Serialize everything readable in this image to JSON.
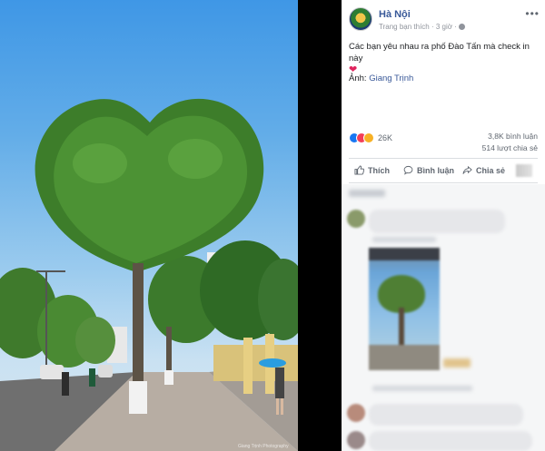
{
  "post": {
    "page_name": "Hà Nội",
    "meta_text": "Trang bạn thích · 3 giờ ·",
    "more_label": "•••",
    "caption": "Các bạn yêu nhau ra phố Đào Tấn mà check in này",
    "emoji": "❤",
    "credit_prefix": "Ảnh: ",
    "credit_name": "Giang Trịnh"
  },
  "engagement": {
    "reaction_count": "26K",
    "comments": "3,8K bình luận",
    "shares": "514 lượt chia sẻ"
  },
  "actions": {
    "like_label": "Thích",
    "comment_label": "Bình luận",
    "share_label": "Chia sẻ"
  },
  "photo": {
    "credit_text": "Giang Trịnh Photography"
  },
  "colors": {
    "link": "#385898",
    "text": "#1c1e21",
    "muted": "#606770",
    "like": "#1877f2",
    "love": "#f33e58",
    "haha": "#f7b125",
    "gutter": "#000000"
  }
}
